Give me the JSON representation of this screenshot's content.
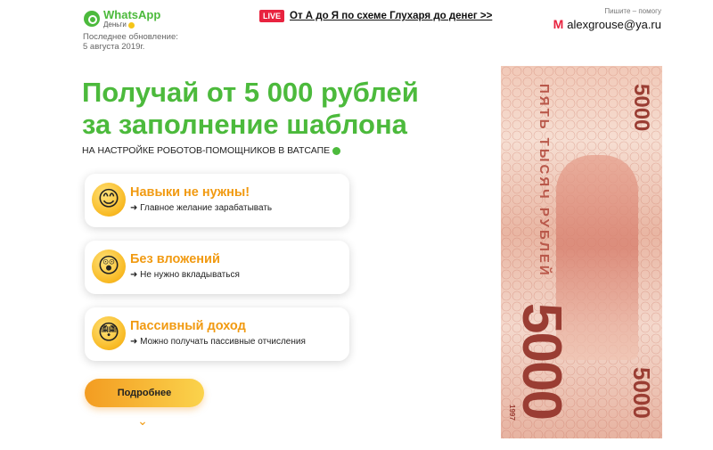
{
  "header": {
    "logo_title": "WhatsApp",
    "logo_sub": "Деньги",
    "updated_line1": "Последнее обновление:",
    "updated_line2": "5 августа 2019г.",
    "live_badge": "LIVE",
    "live_link": "От А до Я по схеме Глухаря до денег >>",
    "contact_hint": "Пишите – помогу",
    "contact_icon": "M",
    "contact_email": "alexgrouse@ya.ru"
  },
  "hero": {
    "headline_line1": "Получай от 5 000 рублей",
    "headline_line2": "за заполнение шаблона",
    "subhead": "НА НАСТРОЙКЕ РОБОТОВ-ПОМОЩНИКОВ В ВАТСАПЕ"
  },
  "features": [
    {
      "emoji": "😊",
      "title": "Навыки не нужны!",
      "desc": "➜ Главное желание зарабатывать"
    },
    {
      "emoji": "😲",
      "title": "Без вложений",
      "desc": "➜ Не нужно вкладываться"
    },
    {
      "emoji": "😳",
      "title": "Пассивный доход",
      "desc": "➜ Можно получать пассивные отчисления"
    }
  ],
  "cta": {
    "button_label": "Подробнее",
    "chevron": "⌄"
  },
  "banknote": {
    "words": "ПЯТЬ ТЫСЯЧ РУБЛЕЙ",
    "big_value": "5000",
    "corner_top": "5000",
    "corner_bottom": "5000",
    "year": "1997"
  },
  "colors": {
    "brand_green": "#4cba3c",
    "accent_orange": "#f19a11",
    "live_red": "#e8233f"
  }
}
